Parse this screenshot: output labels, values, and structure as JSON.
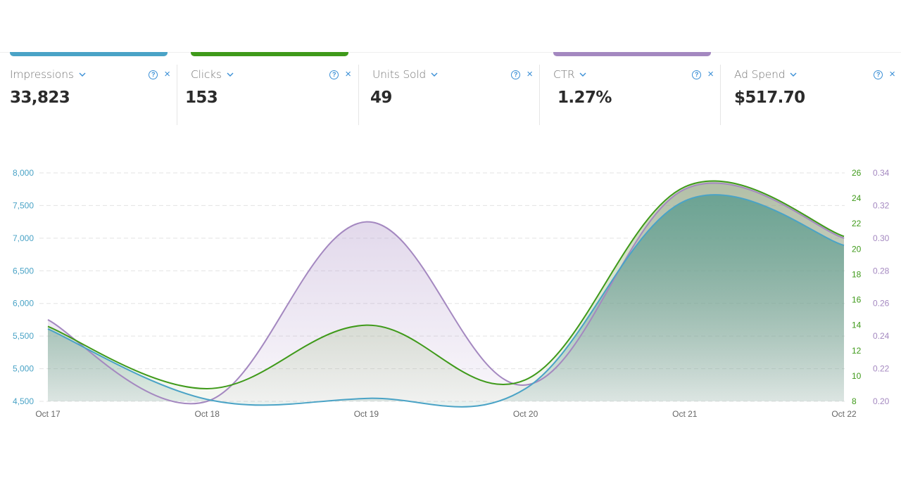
{
  "metrics": [
    {
      "label": "Impressions",
      "value": "33,823",
      "color": "#4aa3c6",
      "active": true
    },
    {
      "label": "Clicks",
      "value": "153",
      "color": "#3f9a1a",
      "active": true
    },
    {
      "label": "Units Sold",
      "value": "49",
      "color": "",
      "active": false
    },
    {
      "label": "CTR",
      "value": "1.27%",
      "color": "#a488c0",
      "active": true
    },
    {
      "label": "Ad Spend",
      "value": "$517.70",
      "color": "",
      "active": false
    }
  ],
  "icons": {
    "dropdown": "chevron-down-icon",
    "help": "help-circle-icon",
    "close": "close-icon",
    "help_glyph": "?",
    "close_glyph": "×"
  },
  "chart_data": {
    "type": "area",
    "title": "",
    "x": [
      "Oct 17",
      "Oct 18",
      "Oct 19",
      "Oct 20",
      "Oct 21",
      "Oct 22"
    ],
    "grid": true,
    "axes": {
      "left": {
        "series": "Impressions",
        "range": [
          4500,
          8000
        ],
        "ticks": [
          "4,500",
          "5,000",
          "5,500",
          "6,000",
          "6,500",
          "7,000",
          "7,500",
          "8,000"
        ],
        "tick_values": [
          4500,
          5000,
          5500,
          6000,
          6500,
          7000,
          7500,
          8000
        ],
        "color": "#4aa3c6"
      },
      "right1": {
        "series": "Clicks",
        "range": [
          8,
          26
        ],
        "ticks": [
          "8",
          "10",
          "12",
          "14",
          "16",
          "18",
          "20",
          "22",
          "24",
          "26"
        ],
        "tick_values": [
          8,
          10,
          12,
          14,
          16,
          18,
          20,
          22,
          24,
          26
        ],
        "color": "#3f9a1a"
      },
      "right2": {
        "series": "CTR",
        "range": [
          0.2,
          0.34
        ],
        "ticks": [
          "0.20",
          "0.22",
          "0.24",
          "0.26",
          "0.28",
          "0.30",
          "0.32",
          "0.34"
        ],
        "tick_values": [
          0.2,
          0.22,
          0.24,
          0.26,
          0.28,
          0.3,
          0.32,
          0.34
        ],
        "color": "#a488c0"
      }
    },
    "series": [
      {
        "name": "CTR",
        "axis": "right2",
        "color": "#a488c0",
        "values": [
          0.25,
          0.2,
          0.31,
          0.21,
          0.33,
          0.3
        ]
      },
      {
        "name": "Clicks",
        "axis": "right1",
        "color": "#3f9a1a",
        "values": [
          13.9,
          9.0,
          14.0,
          9.7,
          24.9,
          21.0
        ]
      },
      {
        "name": "Impressions",
        "axis": "left",
        "color": "#4aa3c6",
        "values": [
          5610,
          4530,
          4545,
          4695,
          7570,
          6890
        ]
      }
    ]
  }
}
